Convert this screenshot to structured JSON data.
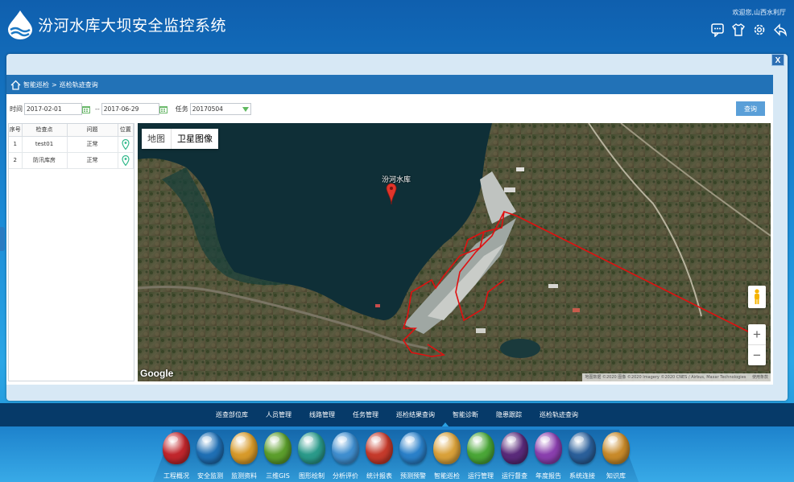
{
  "header": {
    "title": "汾河水库大坝安全监控系统",
    "welcome": "欢迎您,山西水利厅",
    "icons": [
      "message-icon",
      "shirt-theme-icon",
      "settings-gear-icon",
      "back-arrow-icon"
    ]
  },
  "panel": {
    "close_label": "X",
    "breadcrumb": {
      "root": "智能巡检",
      "separator": ">",
      "current": "巡检轨迹查询"
    }
  },
  "filter": {
    "time_label": "时间",
    "start_date": "2017-02-01",
    "dash": "--",
    "end_date": "2017-06-29",
    "task_label": "任务",
    "task_value": "20170504",
    "query_label": "查询"
  },
  "table": {
    "headers": [
      "序号",
      "检查点",
      "问题",
      "位置"
    ],
    "rows": [
      {
        "no": "1",
        "point": "test01",
        "issue": "正常"
      },
      {
        "no": "2",
        "point": "防汛库房",
        "issue": "正常"
      }
    ]
  },
  "map": {
    "type_map": "地图",
    "type_satellite": "卫星图像",
    "marker_label": "汾河水库",
    "zoom_in": "+",
    "zoom_out": "−",
    "google": "Google",
    "attribution": "地图数据 ©2020 图像 ©2020 Imagery ©2020 CNES / Airbus, Maxar Technologies",
    "terms": "使用条款",
    "track_color": "#e01010"
  },
  "subnav": [
    "巡查部位库",
    "人员管理",
    "线路管理",
    "任务管理",
    "巡检结果查询",
    "智能诊断",
    "隐患跟踪",
    "巡检轨迹查询"
  ],
  "dock": [
    {
      "label": "工程概况",
      "color": "#c0262c"
    },
    {
      "label": "安全监测",
      "color": "#1f6fb4"
    },
    {
      "label": "监测资料",
      "color": "#d79a2a"
    },
    {
      "label": "三维GIS",
      "color": "#5c9e2c"
    },
    {
      "label": "图形绘制",
      "color": "#2a9a8a"
    },
    {
      "label": "分析评价",
      "color": "#3f8ecf"
    },
    {
      "label": "统计报表",
      "color": "#c53a2b"
    },
    {
      "label": "预测预警",
      "color": "#2a80c9"
    },
    {
      "label": "智能巡检",
      "color": "#d9a13a"
    },
    {
      "label": "运行管理",
      "color": "#4aa637"
    },
    {
      "label": "运行督查",
      "color": "#5a2a7a"
    },
    {
      "label": "年度报告",
      "color": "#8a3fae"
    },
    {
      "label": "系统连接",
      "color": "#2a5f9a"
    },
    {
      "label": "知识库",
      "color": "#c88a2a"
    }
  ]
}
